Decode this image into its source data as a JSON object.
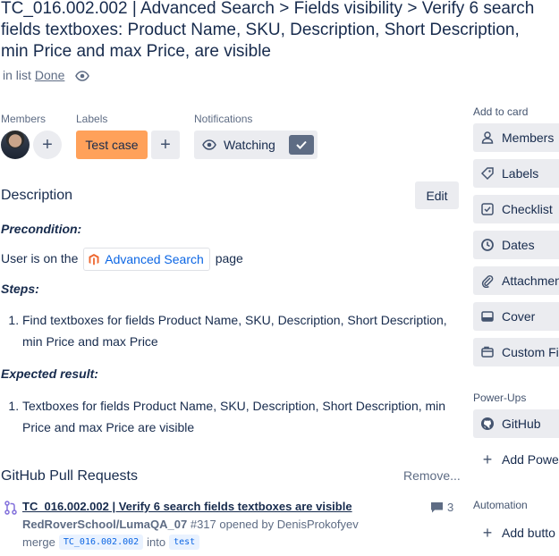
{
  "card": {
    "title": "TC_016.002.002 | Advanced Search > Fields visibility > Verify 6 search\nfields textboxes: Product Name, SKU, Description, Short Description,\nmin Price and max Price, are visible",
    "in_list_prefix": "in list",
    "list_name": "Done"
  },
  "members": {
    "label": "Members",
    "add": "+"
  },
  "labels": {
    "label": "Labels",
    "chip": "Test case",
    "chip_color": "#ffa15a",
    "add": "+"
  },
  "notifications": {
    "label": "Notifications",
    "button": "Watching",
    "checked": true
  },
  "description": {
    "heading": "Description",
    "edit": "Edit",
    "precondition_heading": "Precondition:",
    "precondition_before": "User is on the",
    "precondition_link": "Advanced Search",
    "precondition_after": "page",
    "steps_heading": "Steps:",
    "steps": [
      "Find textboxes for fields Product Name, SKU, Description, Short Description, min Price and max Price"
    ],
    "expected_heading": "Expected result:",
    "expected": [
      "Textboxes for fields Product Name, SKU, Description, Short Description, min Price and max Price are visible"
    ]
  },
  "github_prs": {
    "heading": "GitHub Pull Requests",
    "remove": "Remove...",
    "pr": {
      "title": "TC_016.002.002 | Verify 6 search fields textboxes are visible",
      "comments": "3",
      "repo": "RedRoverSchool/LumaQA_07",
      "meta": "#317 opened by DenisProkofyev",
      "merge_word": "merge",
      "from_branch": "TC_016.002.002",
      "into_word": "into",
      "to_branch": "test"
    }
  },
  "sidebar": {
    "add_to_card": "Add to card",
    "buttons": [
      {
        "label": "Members",
        "icon": "person-icon"
      },
      {
        "label": "Labels",
        "icon": "tag-icon"
      },
      {
        "label": "Checklist",
        "icon": "checklist-icon"
      },
      {
        "label": "Dates",
        "icon": "clock-icon"
      },
      {
        "label": "Attachmen",
        "icon": "paperclip-icon"
      },
      {
        "label": "Cover",
        "icon": "cover-icon"
      },
      {
        "label": "Custom Fie",
        "icon": "custom-fields-icon"
      }
    ],
    "powerups_label": "Power-Ups",
    "github": "GitHub",
    "add_powerup": "Add Powe",
    "automation_label": "Automation",
    "add_button": "Add butto"
  },
  "colors": {
    "accent_link": "#0c66e4",
    "text": "#172b4d",
    "muted": "#5e6c84",
    "button_bg": "#ebecf0"
  }
}
